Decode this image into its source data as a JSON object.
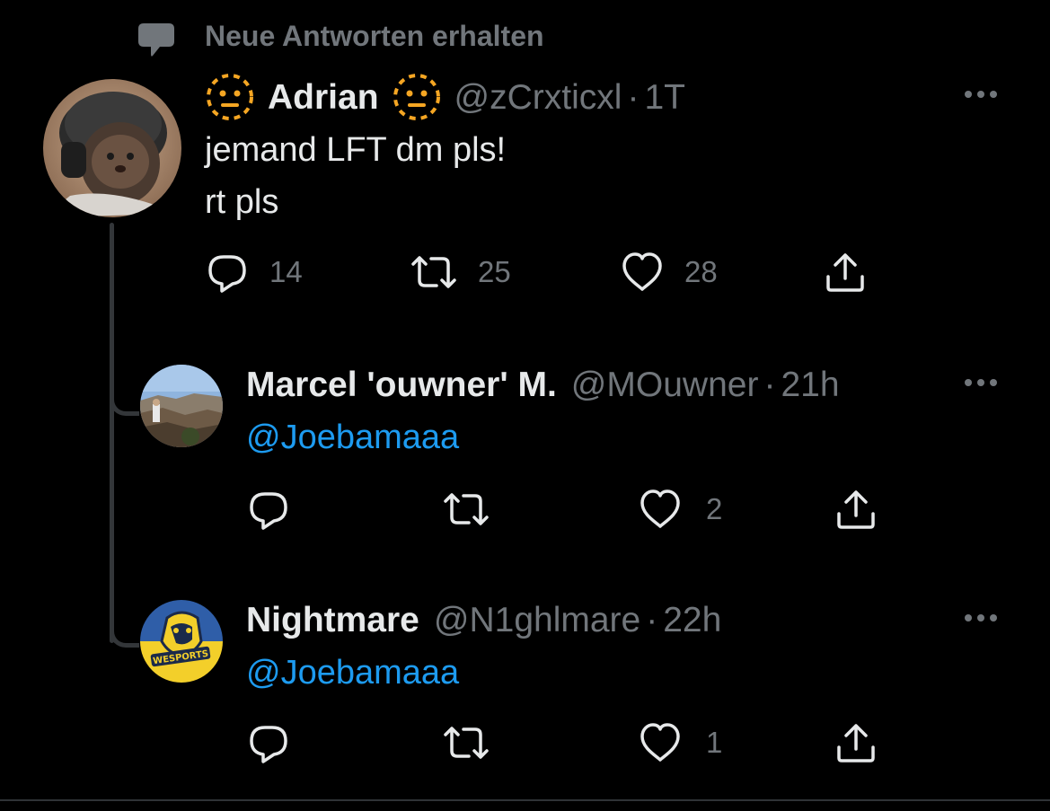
{
  "notice": {
    "text": "Neue Antworten erhalten",
    "icon": "speech-bubble-icon"
  },
  "colors": {
    "background": "#000000",
    "text_primary": "#e7e9ea",
    "text_secondary": "#71767b",
    "mention": "#1d9bf0",
    "thread_line": "#333639",
    "emoji_accent": "#f5a623"
  },
  "main_tweet": {
    "display_name": "Adrian",
    "handle": "@zCrxticxl",
    "separator": "·",
    "time": "1T",
    "name_emoji": "dotted-line-face-icon",
    "text_lines": [
      "jemand LFT dm pls!",
      "rt pls"
    ],
    "actions": {
      "reply_count": "14",
      "retweet_count": "25",
      "like_count": "28"
    },
    "avatar": "cat-with-headset-avatar"
  },
  "replies": [
    {
      "display_name": "Marcel 'ouwner' M.",
      "handle": "@MOuwner",
      "separator": "·",
      "time": "21h",
      "text": "@Joebamaaa",
      "actions": {
        "reply_count": "",
        "retweet_count": "",
        "like_count": "2"
      },
      "avatar": "canyon-landscape-avatar"
    },
    {
      "display_name": "Nightmare",
      "handle": "@N1ghlmare",
      "separator": "·",
      "time": "22h",
      "text": "@Joebamaaa",
      "actions": {
        "reply_count": "",
        "retweet_count": "",
        "like_count": "1"
      },
      "avatar": "wesports-gorilla-logo-avatar",
      "avatar_logo_text": "WESPORTS"
    }
  ]
}
